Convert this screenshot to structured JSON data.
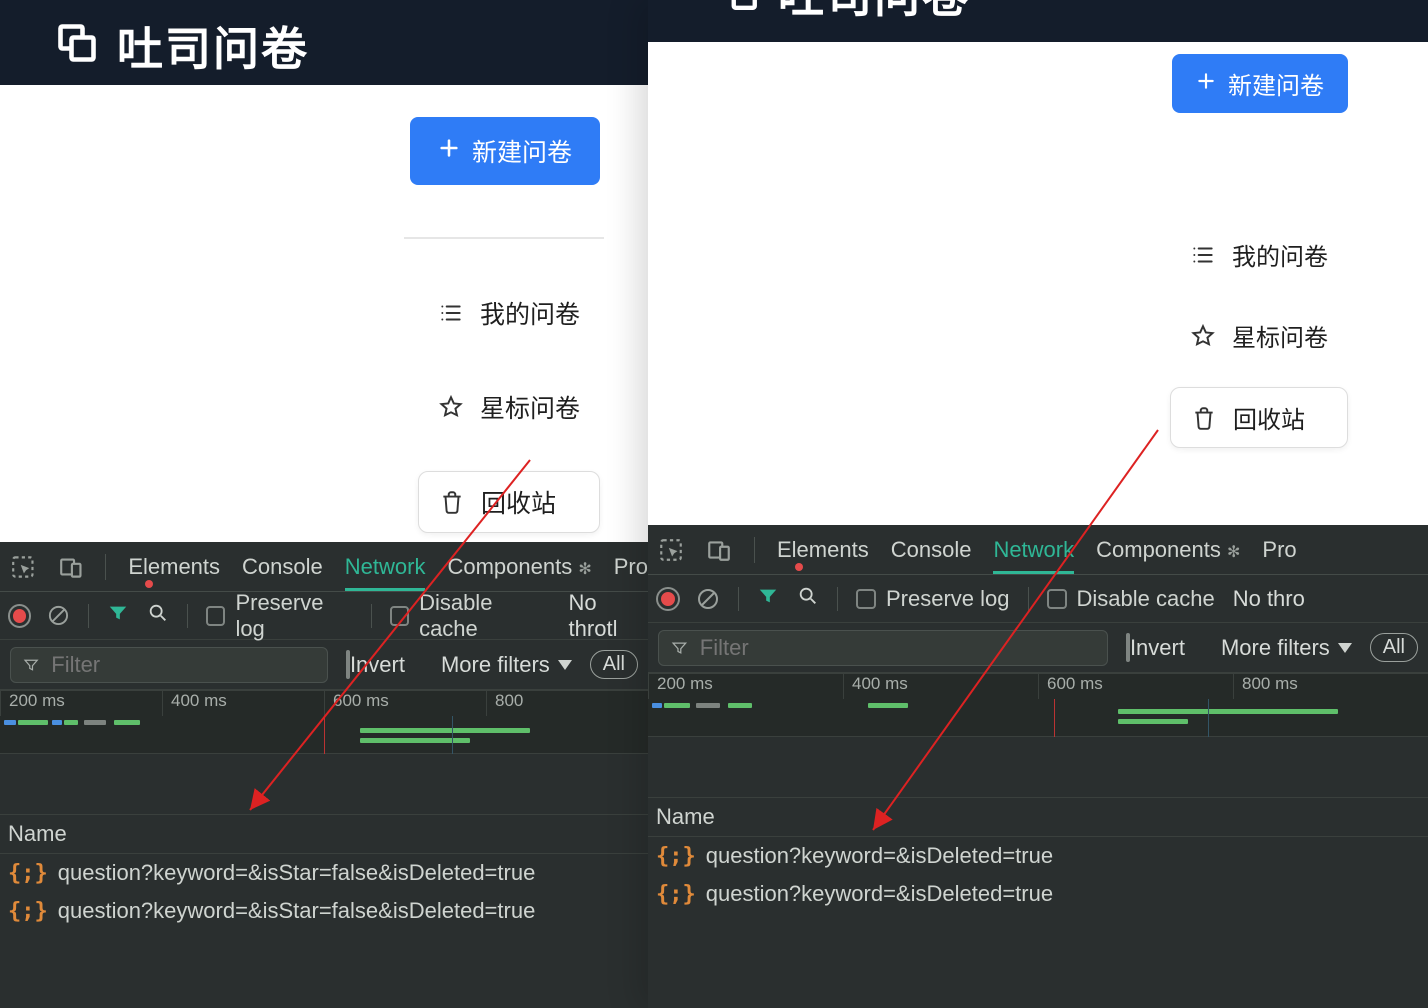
{
  "colors": {
    "primary": "#2f7cf6",
    "devtoolsActive": "#2fb796"
  },
  "leftPane": {
    "header": {
      "title": "吐司问卷"
    },
    "newButton": "新建问卷",
    "nav": [
      {
        "key": "my",
        "label": "我的问卷",
        "icon": "list-icon",
        "active": false
      },
      {
        "key": "star",
        "label": "星标问卷",
        "icon": "star-icon",
        "active": false
      },
      {
        "key": "trash",
        "label": "回收站",
        "icon": "trash-icon",
        "active": true
      }
    ],
    "devtools": {
      "tabs": [
        "Elements",
        "Console",
        "Network",
        "Components",
        "Pro"
      ],
      "activeTab": "Network",
      "preserveLog": "Preserve log",
      "disableCache": "Disable cache",
      "throttling": "No throtl",
      "filterPlaceholder": "Filter",
      "invert": "Invert",
      "moreFilters": "More filters",
      "all": "All",
      "timelineTicks": [
        "200 ms",
        "400 ms",
        "600 ms",
        "800"
      ],
      "nameHeader": "Name",
      "requests": [
        "question?keyword=&isStar=false&isDeleted=true",
        "question?keyword=&isStar=false&isDeleted=true"
      ]
    }
  },
  "rightPane": {
    "header": {
      "title": "吐司问卷"
    },
    "newButton": "新建问卷",
    "nav": [
      {
        "key": "my",
        "label": "我的问卷",
        "icon": "list-icon",
        "active": false
      },
      {
        "key": "star",
        "label": "星标问卷",
        "icon": "star-icon",
        "active": false
      },
      {
        "key": "trash",
        "label": "回收站",
        "icon": "trash-icon",
        "active": true
      }
    ],
    "devtools": {
      "tabs": [
        "Elements",
        "Console",
        "Network",
        "Components",
        "Pro"
      ],
      "activeTab": "Network",
      "preserveLog": "Preserve log",
      "disableCache": "Disable cache",
      "throttling": "No thro",
      "filterPlaceholder": "Filter",
      "invert": "Invert",
      "moreFilters": "More filters",
      "all": "All",
      "timelineTicks": [
        "200 ms",
        "400 ms",
        "600 ms",
        "800 ms"
      ],
      "nameHeader": "Name",
      "requests": [
        "question?keyword=&isDeleted=true",
        "question?keyword=&isDeleted=true"
      ]
    }
  }
}
